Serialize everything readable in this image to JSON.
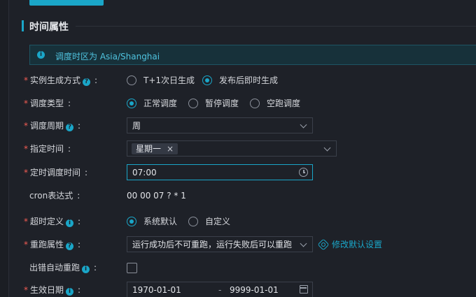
{
  "top_button": {
    "label": ""
  },
  "section": {
    "title": "时间属性"
  },
  "info": {
    "text": "调度时区为 Asia/Shanghai"
  },
  "fields": {
    "instance_mode": {
      "label": "实例生成方式",
      "suffix": ":",
      "options": [
        "T+1次日生成",
        "发布后即时生成"
      ],
      "selected": 1
    },
    "schedule_type": {
      "label": "调度类型",
      "suffix": ":",
      "options": [
        "正常调度",
        "暂停调度",
        "空跑调度"
      ],
      "selected": 0
    },
    "schedule_cycle": {
      "label": "调度周期",
      "suffix": ":",
      "value": "周"
    },
    "specified_time": {
      "label": "指定时间",
      "suffix": ":",
      "tag": "星期一",
      "tag_close": "×"
    },
    "timed_time": {
      "label": "定时调度时间",
      "suffix": ":",
      "value": "07:00"
    },
    "cron": {
      "label": "cron表达式",
      "suffix": ":",
      "value": "00 00 07 ? * 1"
    },
    "timeout": {
      "label": "超时定义",
      "suffix": ":",
      "options": [
        "系统默认",
        "自定义"
      ],
      "selected": 0
    },
    "rerun": {
      "label": "重跑属性",
      "suffix": ":",
      "value": "运行成功后不可重跑，运行失败后可以重跑",
      "link": "修改默认设置"
    },
    "auto_rerun": {
      "label": "出错自动重跑",
      "suffix": ":",
      "checked": false
    },
    "effective_date": {
      "label": "生效日期",
      "suffix": ":",
      "start": "1970-01-01",
      "separator": "-",
      "end": "9999-01-01"
    }
  },
  "icons": {
    "help": "?",
    "info": "i"
  },
  "colors": {
    "accent": "#1aa6c8",
    "required": "#f25c54",
    "background": "#1e2128"
  }
}
